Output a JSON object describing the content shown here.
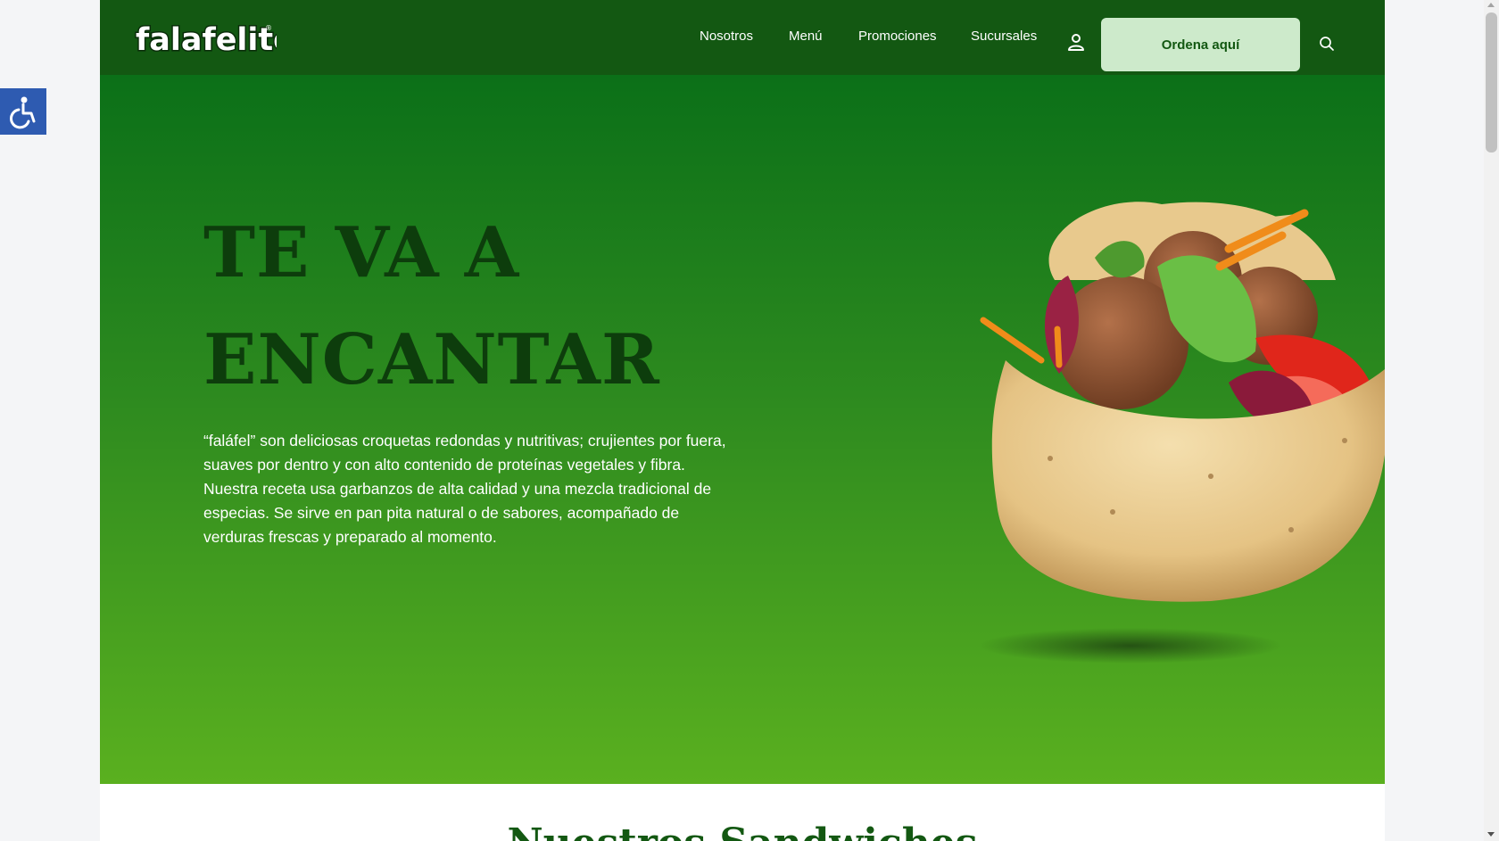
{
  "brand": {
    "logo_text": "falafelito",
    "trademark": "®"
  },
  "nav": {
    "links": [
      {
        "label": "Nosotros"
      },
      {
        "label": "Menú"
      },
      {
        "label": "Promociones"
      },
      {
        "label": "Sucursales"
      }
    ],
    "user_icon": "user-icon",
    "cta_label": "Ordena aquí",
    "search_icon": "search-icon"
  },
  "hero": {
    "title": "TE VA A ENCANTAR",
    "description": "“faláfel” son deliciosas croquetas redondas y nutritivas; crujientes por fuera, suaves por dentro y con alto contenido de proteínas vegetales y fibra. Nuestra receta usa garbanzos de alta calidad y una mezcla tradicional de especias. Se sirve en pan pita natural o de sabores, acompañado de verduras frescas y preparado al momento."
  },
  "next_section": {
    "title": "Nuestros Sandwiches"
  },
  "accessibility": {
    "icon": "accessibility-icon"
  },
  "colors": {
    "nav_bg": "#135812",
    "hero_top": "#0b7018",
    "hero_bottom": "#5ab01f",
    "title_color": "#0d3d0c",
    "cta_bg": "#cdeacb",
    "a11y_bg": "#2e5bb1"
  }
}
